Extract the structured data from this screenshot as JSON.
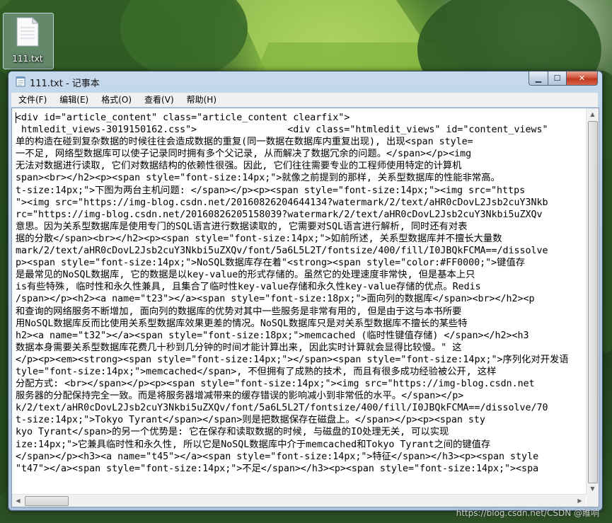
{
  "desktop": {
    "icon_label": "111.txt"
  },
  "window": {
    "title": "111.txt - 记事本",
    "caption": {
      "minimize": "▁",
      "maximize": "☐",
      "close": "✕"
    }
  },
  "menu": [
    "文件(F)",
    "编辑(E)",
    "格式(O)",
    "查看(V)",
    "帮助(H)"
  ],
  "editor": {
    "lines": [
      "<div id=\"article_content\" class=\"article_content clearfix\">",
      " htmledit_views-3019150162.css\">                <div class=\"htmledit_views\" id=\"content_views\"",
      "单的构造在碰到复杂数据的时候往往会造成数据的重复(同一数据在数据库内重复出现), 出现<span style=",
      "一不足, 网络型数据库可以使子记录同时拥有多个父记录, 从而解决了数据冗余的问题。</span></p><img",
      "无法对数据进行读取, 它们对数据结构的依赖性很强。因此, 它们往往需要专业的工程师使用特定的计算机",
      "span><br></h2><p><span style=\"font-size:14px;\">就像之前提到的那样, 关系型数据库的性能非常高。",
      "t-size:14px;\">下图为两台主机问题: </span></p><p><span style=\"font-size:14px;\"><img src=\"https",
      "\"><img src=\"https://img-blog.csdn.net/20160826204644134?watermark/2/text/aHR0cDovL2Jsb2cuY3Nkb",
      "rc=\"https://img-blog.csdn.net/20160826205158039?watermark/2/text/aHR0cDovL2Jsb2cuY3Nkbi5uZXQv",
      "意思。因为关系型数据库是使用专门的SQL语言进行数据读取的, 它需要对SQL语言进行解析, 同时还有对表",
      "据的分散</span><br></h2><p><span style=\"font-size:14px;\">如前所述, 关系型数据库并不擅长大量数",
      "mark/2/text/aHR0cDovL2Jsb2cuY3Nkbi5uZXQv/font/5a6L5L2T/fontsize/400/fill/I0JBQkFCMA==/dissolve",
      "p><span style=\"font-size:14px;\">NoSQL数据库存在着\"<strong><span style=\"color:#FF0000;\">键值存",
      "是最常见的NoSQL数据库, 它的数据是以key-value的形式存储的。虽然它的处理速度非常快, 但是基本上只",
      "is有些特殊, 临时性和永久性兼具, 且集合了临时性key-value存储和永久性key-value存储的优点。Redis",
      "/span></p><h2><a name=\"t23\"></a><span style=\"font-size:18px;\">面向列的数据库</span><br></h2><p",
      "和查询的网络服务不断增加, 面向列的数据库的优势对其中一些服务是非常有用的, 但是由于这与本书所要",
      "用NoSQL数据库反而比使用关系型数据库效果更差的情况。NoSQL数据库只是对关系型数据库不擅长的某些特",
      "h2><a name=\"t32\"></a><span style=\"font-size:18px;\">memcached (临时性键值存储) </span></h2><h3",
      "数据本身需要关系型数据库花费几十秒到几分钟的时间才能计算出来, 因此实时计算就会显得比较慢。\" 这",
      "</p><p><em><strong><span style=\"font-size:14px;\"></span><span style=\"font-size:14px;\">序列化对开发语",
      "tyle=\"font-size:14px;\">memcached</span>, 不但拥有了成熟的技术, 而且有很多成功经验被公开, 这样",
      "分配方式: <br></span></p><p><span style=\"font-size:14px;\"><img src=\"https://img-blog.csdn.net",
      "服务器的分配保持完全一致。而是将服务器增减带来的缓存错误的影响减小到非常低的水平。</span></p>",
      "k/2/text/aHR0cDovL2Jsb2cuY3Nkbi5uZXQv/font/5a6L5L2T/fontsize/400/fill/I0JBQkFCMA==/dissolve/70",
      "t-size:14px;\">Tokyo Tyrant</span></span>则是把数据保存在磁盘上。</span></p><p><span sty",
      "kyo Tyrant</span>的另一个优势是: 它在保存和读取数据的时候, 与磁盘的IO处理无关, 可以实现",
      "ize:14px;\">它兼具临时性和永久性, 所以它是NoSQL数据库中介于memcached和Tokyo Tyrant之间的键值存",
      "</span></p><h3><a name=\"t45\"></a><span style=\"font-size:14px;\">特征</span></h3><p><span style",
      "\"t47\"></a><span style=\"font-size:14px;\">不足</span></h3><p><span style=\"font-size:14px;\"><spa"
    ]
  },
  "watermark": "https://blog.csdn.net/CSDN @睢响"
}
